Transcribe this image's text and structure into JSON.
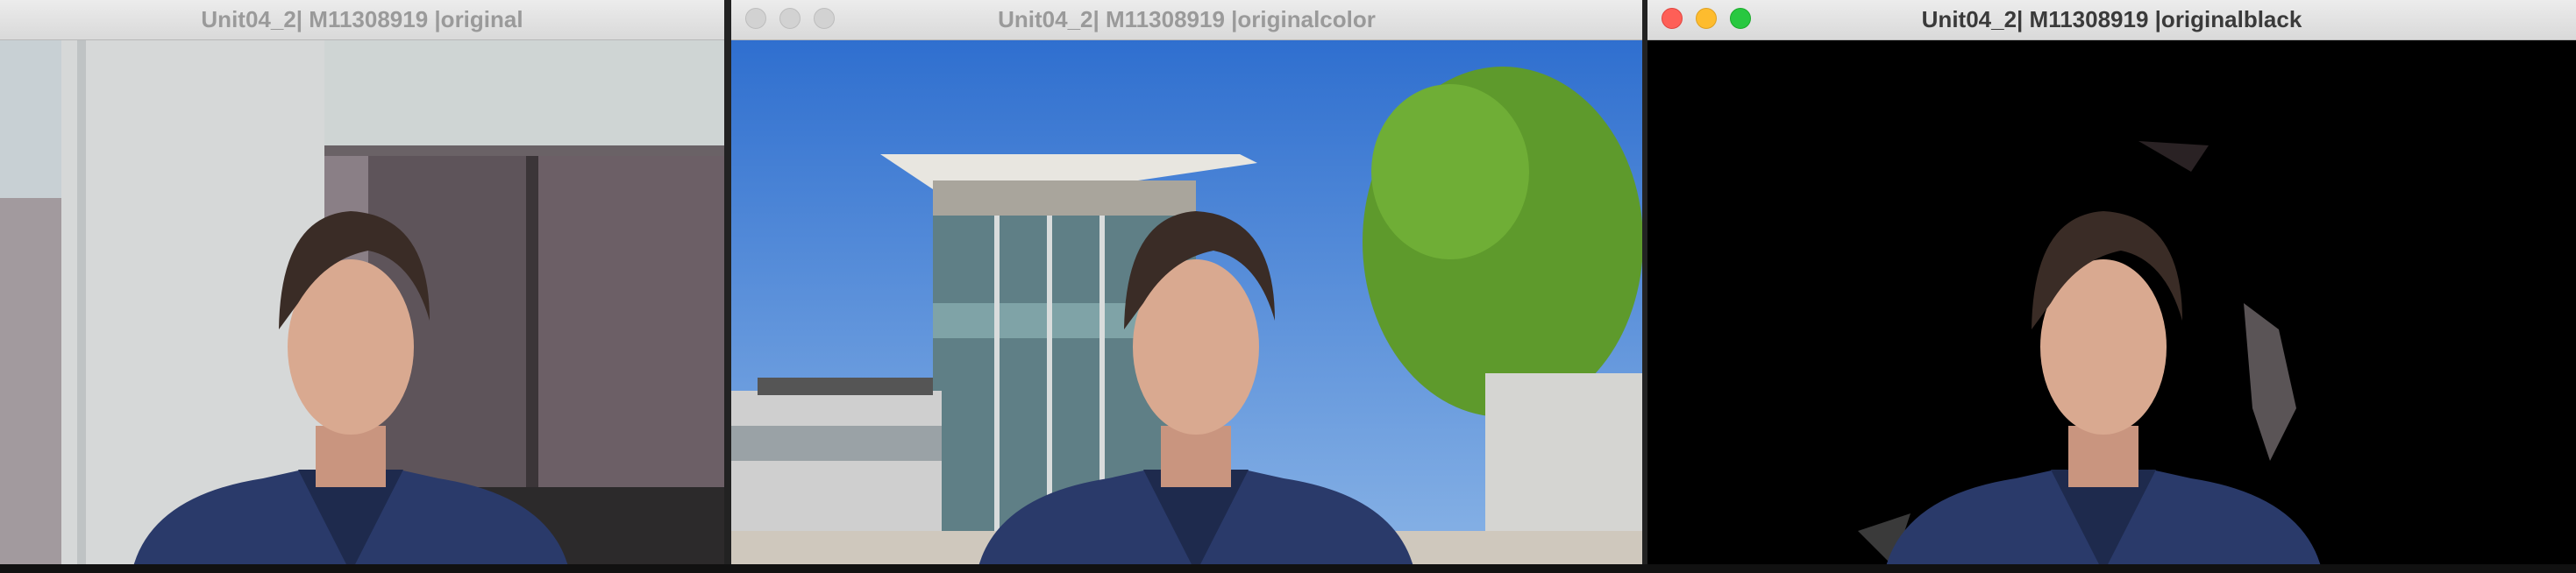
{
  "windows": [
    {
      "title": "Unit04_2| M11308919 |original",
      "state": "inactive",
      "background": "office-window"
    },
    {
      "title": "Unit04_2| M11308919 |originalcolor",
      "state": "inactive",
      "background": "glass-building-and-tree"
    },
    {
      "title": "Unit04_2| M11308919 |originalblack",
      "state": "active",
      "background": "black"
    }
  ],
  "colors": {
    "sky": "#3a7bd5",
    "tree": "#5e9a2c",
    "shirt": "#2a3a6a",
    "skin": "#d9a990",
    "hair": "#3a2c26"
  },
  "icons": [
    "close-button",
    "minimize-button",
    "zoom-button"
  ]
}
